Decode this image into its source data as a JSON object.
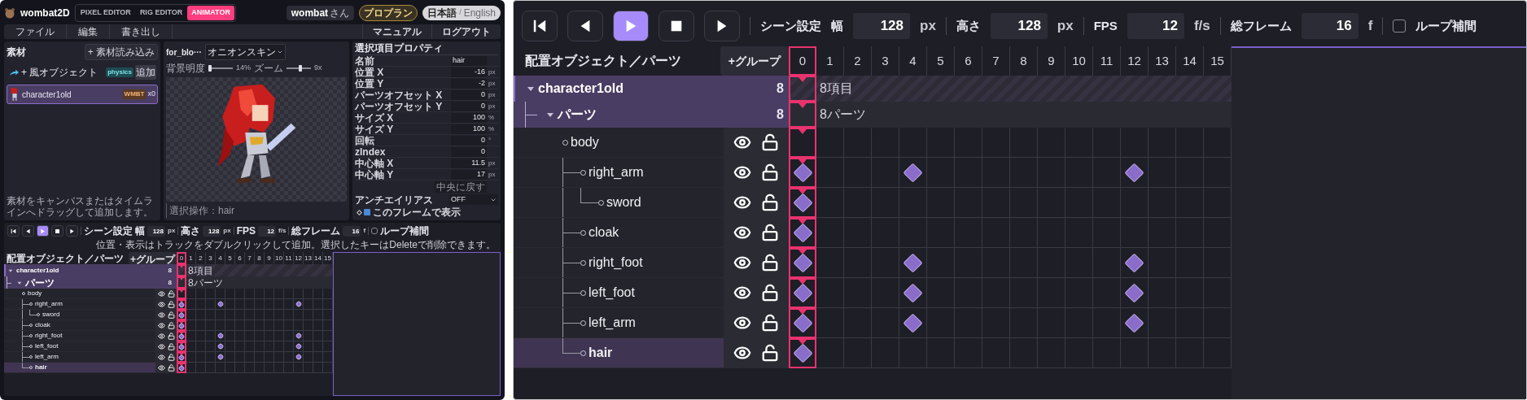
{
  "left_app": {
    "header": {
      "logo": "wombat2D",
      "modes": [
        {
          "label": "PIXEL EDITOR",
          "selected": false
        },
        {
          "label": "RIG EDITOR",
          "selected": false
        },
        {
          "label": "ANIMATOR",
          "selected": true
        }
      ],
      "user": "wombat",
      "user_suffix": "さん",
      "plan": "プロプラン",
      "languages": [
        {
          "label": "日本語",
          "selected": true
        },
        {
          "label": "English",
          "selected": false
        }
      ],
      "language_separator": "/"
    },
    "menu": {
      "left": [
        "ファイル",
        "編集",
        "書き出し"
      ],
      "right": [
        "マニュアル",
        "ログアウト"
      ]
    },
    "materials": {
      "title": "素材",
      "import_button": "+ 素材読み込み",
      "items": [
        {
          "kind": "wind",
          "name": "+ 風オブジェクト",
          "badge": "physics",
          "action": "追加",
          "selected": false
        },
        {
          "kind": "character",
          "name": "character1old",
          "badge": "WMBT",
          "count": "x0",
          "selected": true
        }
      ],
      "hint": "素材をキャンバスまたはタイムラインへドラッグして追加します。"
    },
    "canvas": {
      "title": "for_blo···",
      "onion_skin": "オニオンスキン",
      "brightness": {
        "label": "背景明度",
        "level": 0.08,
        "reading": "14%"
      },
      "zoom": {
        "label": "ズーム",
        "level": 0.55,
        "reading": "9x"
      },
      "status": "選択操作：hair"
    },
    "properties": {
      "title": "選択項目プロパティ",
      "rows": [
        {
          "label": "名前",
          "value": "hair"
        },
        {
          "label": "位置 X",
          "value": "-16",
          "unit": "px"
        },
        {
          "label": "位置 Y",
          "value": "-2",
          "unit": "px"
        },
        {
          "label": "パーツオフセット X",
          "value": "0",
          "unit": "px"
        },
        {
          "label": "パーツオフセット Y",
          "value": "0",
          "unit": "px"
        },
        {
          "label": "サイズ X",
          "value": "100",
          "unit": "%"
        },
        {
          "label": "サイズ Y",
          "value": "100",
          "unit": "%"
        },
        {
          "label": "回転",
          "value": "0",
          "unit": "°"
        },
        {
          "label": "zIndex",
          "value": "0"
        },
        {
          "label": "中心軸 X",
          "value": "11.5",
          "unit": "px"
        },
        {
          "label": "中心軸 Y",
          "value": "17",
          "unit": "px"
        }
      ],
      "reset_button": "中央に戻す",
      "antialias": {
        "label": "アンチエイリアス",
        "value": "OFF"
      },
      "show_in_frame": {
        "label": "このフレームで表示",
        "checked": true
      }
    },
    "timeline": {
      "transport": [
        {
          "kind": "first",
          "selected": false
        },
        {
          "kind": "prev",
          "selected": false
        },
        {
          "kind": "play",
          "selected": true
        },
        {
          "kind": "stop",
          "selected": false
        },
        {
          "kind": "next",
          "selected": false
        }
      ],
      "scene_label": "シーン設定",
      "fields": [
        {
          "label": "幅",
          "value": "128",
          "unit": "px"
        },
        {
          "label": "高さ",
          "value": "128",
          "unit": "px"
        },
        {
          "label": "FPS",
          "value": "12",
          "unit": "f/s"
        },
        {
          "label": "総フレーム",
          "value": "16",
          "unit": "f"
        }
      ],
      "loop": {
        "label": "ループ補間",
        "checked": false
      },
      "help": "位置・表示はトラックをダブルクリックして追加。選択したキーはDeleteで削除できます。",
      "tracks_header": "配置オブジェクト／パーツ",
      "group_button": "+グループ",
      "frames": [
        {
          "label": "0",
          "selected": true
        },
        {
          "label": "1",
          "selected": false
        },
        {
          "label": "2",
          "selected": false
        },
        {
          "label": "3",
          "selected": false
        },
        {
          "label": "4",
          "selected": false
        },
        {
          "label": "5",
          "selected": false
        },
        {
          "label": "6",
          "selected": false
        },
        {
          "label": "7",
          "selected": false
        },
        {
          "label": "8",
          "selected": false
        },
        {
          "label": "9",
          "selected": false
        },
        {
          "label": "10",
          "selected": false
        },
        {
          "label": "11",
          "selected": false
        },
        {
          "label": "12",
          "selected": false
        },
        {
          "label": "13",
          "selected": false
        },
        {
          "label": "14",
          "selected": false
        },
        {
          "label": "15",
          "selected": false
        }
      ],
      "objects": [
        {
          "name": "character1old",
          "count": "8",
          "summary": "8項目",
          "expanded": true,
          "groups": [
            {
              "name": "パーツ",
              "count": "8",
              "summary": "8パーツ",
              "expanded": true,
              "parts": [
                {
                  "name": "body",
                  "visible": true,
                  "locked": false,
                  "selected": false,
                  "keys": [
                    false,
                    false,
                    false,
                    false,
                    false,
                    false,
                    false,
                    false,
                    false,
                    false,
                    false,
                    false,
                    false,
                    false,
                    false,
                    false
                  ],
                  "children": [
                    {
                      "name": "right_arm",
                      "visible": true,
                      "locked": false,
                      "selected": false,
                      "keys": [
                        true,
                        false,
                        false,
                        false,
                        true,
                        false,
                        false,
                        false,
                        false,
                        false,
                        false,
                        false,
                        true,
                        false,
                        false,
                        false
                      ],
                      "children": [
                        {
                          "name": "sword",
                          "visible": true,
                          "locked": false,
                          "selected": false,
                          "keys": [
                            true,
                            false,
                            false,
                            false,
                            false,
                            false,
                            false,
                            false,
                            false,
                            false,
                            false,
                            false,
                            false,
                            false,
                            false,
                            false
                          ]
                        }
                      ]
                    },
                    {
                      "name": "cloak",
                      "visible": true,
                      "locked": false,
                      "selected": false,
                      "keys": [
                        true,
                        false,
                        false,
                        false,
                        false,
                        false,
                        false,
                        false,
                        false,
                        false,
                        false,
                        false,
                        false,
                        false,
                        false,
                        false
                      ]
                    },
                    {
                      "name": "right_foot",
                      "visible": true,
                      "locked": false,
                      "selected": false,
                      "keys": [
                        true,
                        false,
                        false,
                        false,
                        true,
                        false,
                        false,
                        false,
                        false,
                        false,
                        false,
                        false,
                        true,
                        false,
                        false,
                        false
                      ]
                    },
                    {
                      "name": "left_foot",
                      "visible": true,
                      "locked": false,
                      "selected": false,
                      "keys": [
                        true,
                        false,
                        false,
                        false,
                        true,
                        false,
                        false,
                        false,
                        false,
                        false,
                        false,
                        false,
                        true,
                        false,
                        false,
                        false
                      ]
                    },
                    {
                      "name": "left_arm",
                      "visible": true,
                      "locked": false,
                      "selected": false,
                      "keys": [
                        true,
                        false,
                        false,
                        false,
                        true,
                        false,
                        false,
                        false,
                        false,
                        false,
                        false,
                        false,
                        true,
                        false,
                        false,
                        false
                      ]
                    },
                    {
                      "name": "hair",
                      "visible": true,
                      "locked": false,
                      "selected": true,
                      "keys": [
                        true,
                        false,
                        false,
                        false,
                        false,
                        false,
                        false,
                        false,
                        false,
                        false,
                        false,
                        false,
                        false,
                        false,
                        false,
                        false
                      ]
                    }
                  ]
                }
              ]
            }
          ]
        }
      ]
    }
  },
  "zoomed_view": {
    "timeline": {
      "transport": [
        {
          "kind": "first",
          "selected": false
        },
        {
          "kind": "prev",
          "selected": false
        },
        {
          "kind": "play",
          "selected": true
        },
        {
          "kind": "stop",
          "selected": false
        },
        {
          "kind": "next",
          "selected": false
        }
      ],
      "scene_label": "シーン設定",
      "fields": [
        {
          "label": "幅",
          "value": "128",
          "unit": "px"
        },
        {
          "label": "高さ",
          "value": "128",
          "unit": "px"
        },
        {
          "label": "FPS",
          "value": "12",
          "unit": "f/s"
        },
        {
          "label": "総フレーム",
          "value": "16",
          "unit": "f"
        }
      ],
      "loop": {
        "label": "ループ補間",
        "checked": false
      },
      "tracks_header": "配置オブジェクト／パーツ",
      "group_button": "+グループ",
      "frames": [
        {
          "label": "0",
          "selected": true
        },
        {
          "label": "1",
          "selected": false
        },
        {
          "label": "2",
          "selected": false
        },
        {
          "label": "3",
          "selected": false
        },
        {
          "label": "4",
          "selected": false
        },
        {
          "label": "5",
          "selected": false
        },
        {
          "label": "6",
          "selected": false
        },
        {
          "label": "7",
          "selected": false
        },
        {
          "label": "8",
          "selected": false
        },
        {
          "label": "9",
          "selected": false
        },
        {
          "label": "10",
          "selected": false
        },
        {
          "label": "11",
          "selected": false
        },
        {
          "label": "12",
          "selected": false
        },
        {
          "label": "13",
          "selected": false
        },
        {
          "label": "14",
          "selected": false
        },
        {
          "label": "15",
          "selected": false
        }
      ],
      "objects": [
        {
          "name": "character1old",
          "count": "8",
          "summary": "8項目",
          "expanded": true,
          "groups": [
            {
              "name": "パーツ",
              "count": "8",
              "summary": "8パーツ",
              "expanded": true,
              "parts": [
                {
                  "name": "body",
                  "visible": true,
                  "locked": false,
                  "selected": false,
                  "keys": [
                    false,
                    false,
                    false,
                    false,
                    false,
                    false,
                    false,
                    false,
                    false,
                    false,
                    false,
                    false,
                    false,
                    false,
                    false,
                    false
                  ],
                  "children": [
                    {
                      "name": "right_arm",
                      "visible": true,
                      "locked": false,
                      "selected": false,
                      "keys": [
                        true,
                        false,
                        false,
                        false,
                        true,
                        false,
                        false,
                        false,
                        false,
                        false,
                        false,
                        false,
                        true,
                        false,
                        false,
                        false
                      ],
                      "children": [
                        {
                          "name": "sword",
                          "visible": true,
                          "locked": false,
                          "selected": false,
                          "keys": [
                            true,
                            false,
                            false,
                            false,
                            false,
                            false,
                            false,
                            false,
                            false,
                            false,
                            false,
                            false,
                            false,
                            false,
                            false,
                            false
                          ]
                        }
                      ]
                    },
                    {
                      "name": "cloak",
                      "visible": true,
                      "locked": false,
                      "selected": false,
                      "keys": [
                        true,
                        false,
                        false,
                        false,
                        false,
                        false,
                        false,
                        false,
                        false,
                        false,
                        false,
                        false,
                        false,
                        false,
                        false,
                        false
                      ]
                    },
                    {
                      "name": "right_foot",
                      "visible": true,
                      "locked": false,
                      "selected": false,
                      "keys": [
                        true,
                        false,
                        false,
                        false,
                        true,
                        false,
                        false,
                        false,
                        false,
                        false,
                        false,
                        false,
                        true,
                        false,
                        false,
                        false
                      ]
                    },
                    {
                      "name": "left_foot",
                      "visible": true,
                      "locked": false,
                      "selected": false,
                      "keys": [
                        true,
                        false,
                        false,
                        false,
                        true,
                        false,
                        false,
                        false,
                        false,
                        false,
                        false,
                        false,
                        true,
                        false,
                        false,
                        false
                      ]
                    },
                    {
                      "name": "left_arm",
                      "visible": true,
                      "locked": false,
                      "selected": false,
                      "keys": [
                        true,
                        false,
                        false,
                        false,
                        true,
                        false,
                        false,
                        false,
                        false,
                        false,
                        false,
                        false,
                        true,
                        false,
                        false,
                        false
                      ]
                    },
                    {
                      "name": "hair",
                      "visible": true,
                      "locked": false,
                      "selected": true,
                      "keys": [
                        true,
                        false,
                        false,
                        false,
                        false,
                        false,
                        false,
                        false,
                        false,
                        false,
                        false,
                        false,
                        false,
                        false,
                        false,
                        false
                      ]
                    }
                  ]
                }
              ]
            }
          ]
        }
      ]
    }
  }
}
